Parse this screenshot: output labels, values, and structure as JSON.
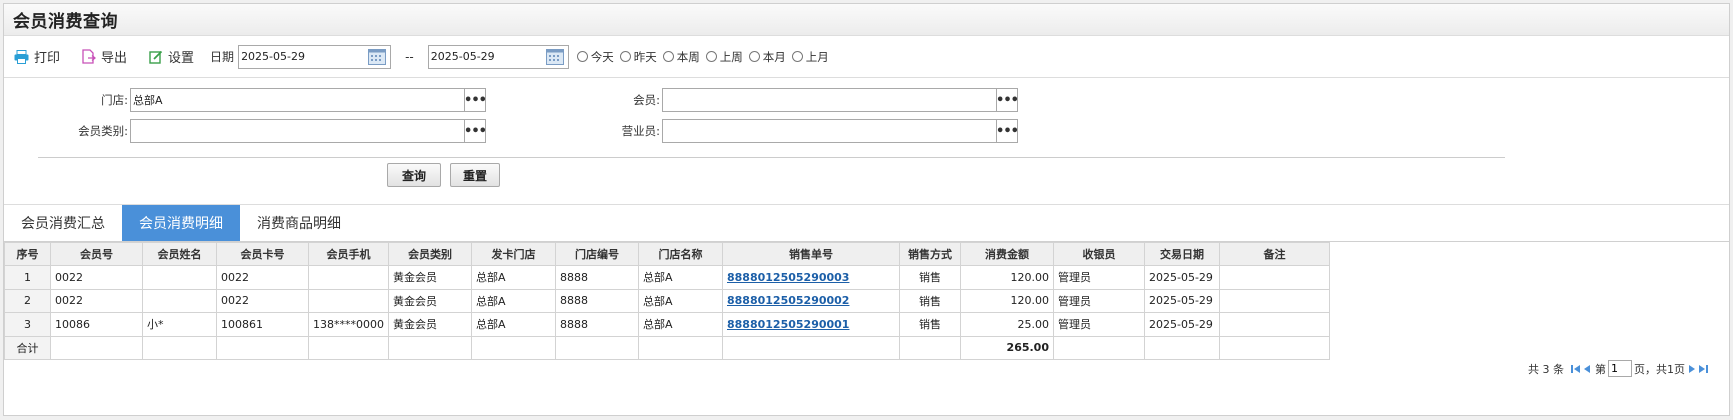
{
  "page": {
    "title": "会员消费查询"
  },
  "toolbar": {
    "print_label": "打印",
    "export_label": "导出",
    "settings_label": "设置",
    "date_label": "日期",
    "date_from": "2025-05-29",
    "date_sep": "--",
    "date_to": "2025-05-29",
    "quick_dates": [
      "今天",
      "昨天",
      "本周",
      "上周",
      "本月",
      "上月"
    ]
  },
  "filters": {
    "store_label": "门店:",
    "store_value": "总部A",
    "member_label": "会员:",
    "member_value": "",
    "member_type_label": "会员类别:",
    "member_type_value": "",
    "clerk_label": "营业员:",
    "clerk_value": "",
    "query_button": "查询",
    "reset_button": "重置"
  },
  "tabs": [
    {
      "label": "会员消费汇总",
      "active": false
    },
    {
      "label": "会员消费明细",
      "active": true
    },
    {
      "label": "消费商品明细",
      "active": false
    }
  ],
  "table": {
    "headers": [
      "序号",
      "会员号",
      "会员姓名",
      "会员卡号",
      "会员手机",
      "会员类别",
      "发卡门店",
      "门店编号",
      "门店名称",
      "销售单号",
      "销售方式",
      "消费金额",
      "收银员",
      "交易日期",
      "备注"
    ],
    "rows": [
      [
        "1",
        "0022",
        "",
        "0022",
        "",
        "黄金会员",
        "总部A",
        "8888",
        "总部A",
        "8888012505290003",
        "销售",
        "120.00",
        "管理员",
        "2025-05-29",
        ""
      ],
      [
        "2",
        "0022",
        "",
        "0022",
        "",
        "黄金会员",
        "总部A",
        "8888",
        "总部A",
        "8888012505290002",
        "销售",
        "120.00",
        "管理员",
        "2025-05-29",
        ""
      ],
      [
        "3",
        "10086",
        "小*",
        "100861",
        "138****0000",
        "黄金会员",
        "总部A",
        "8888",
        "总部A",
        "8888012505290001",
        "销售",
        "25.00",
        "管理员",
        "2025-05-29",
        ""
      ]
    ],
    "total_label": "合计",
    "total_amount": "265.00"
  },
  "pager": {
    "total_text": "共 3 条",
    "page_prefix": "第",
    "page_value": "1",
    "page_suffix": "页，共1页"
  },
  "colors": {
    "accent": "#4a90d9",
    "link": "#1c5fa8"
  }
}
